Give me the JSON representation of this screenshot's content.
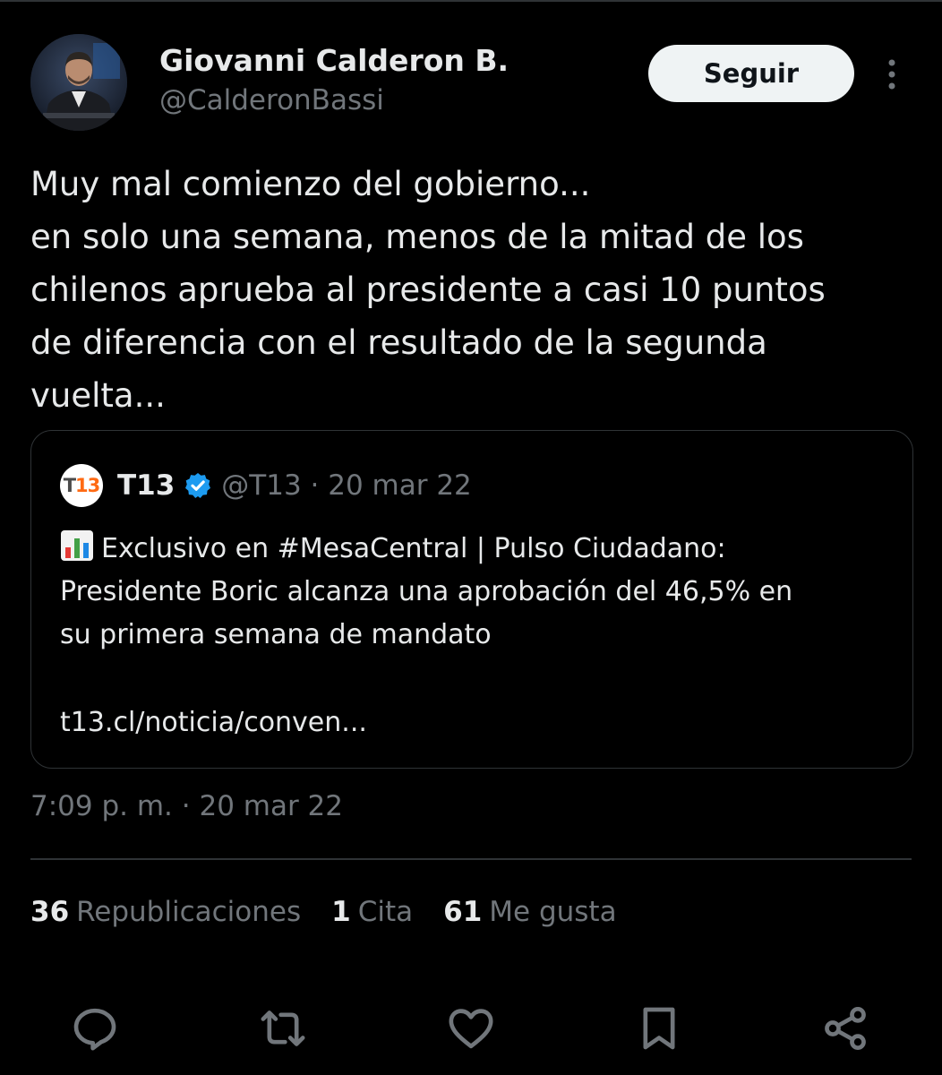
{
  "author": {
    "display_name": "Giovanni Calderon B.",
    "handle": "@CalderonBassi"
  },
  "follow_button": {
    "label": "Seguir"
  },
  "tweet": {
    "lines": [
      "Muy mal comienzo del gobierno...",
      "en solo una semana, menos de la mitad de los",
      "chilenos aprueba al presidente a casi 10 puntos",
      "de diferencia con el resultado de la segunda",
      "vuelta..."
    ]
  },
  "quoted": {
    "logo_text_left": "T",
    "logo_text_right": "13",
    "name": "T13",
    "meta": "@T13 · 20 mar 22",
    "lines": [
      "Exclusivo en #MesaCentral | Pulso Ciudadano:",
      "Presidente Boric alcanza una aprobación del 46,5% en",
      "su primera semana de mandato"
    ],
    "link": "t13.cl/noticia/conven..."
  },
  "timestamp": "7:09 p. m. · 20 mar 22",
  "stats": {
    "reposts": {
      "value": "36",
      "label": "Republicaciones"
    },
    "quotes": {
      "value": "1",
      "label": "Cita"
    },
    "likes": {
      "value": "61",
      "label": "Me gusta"
    }
  },
  "icons": {
    "more": "more-vertical-icon",
    "verified": "verified-badge-icon",
    "chart": "bar-chart-emoji-icon",
    "reply": "reply-icon",
    "repost": "repost-icon",
    "like": "heart-icon",
    "bookmark": "bookmark-icon",
    "share": "share-icon"
  },
  "colors": {
    "background": "#000000",
    "text": "#e7e9ea",
    "muted": "#71767b",
    "border": "#2f3336",
    "verified": "#1d9bf0",
    "t13_orange": "#ff6a13"
  }
}
